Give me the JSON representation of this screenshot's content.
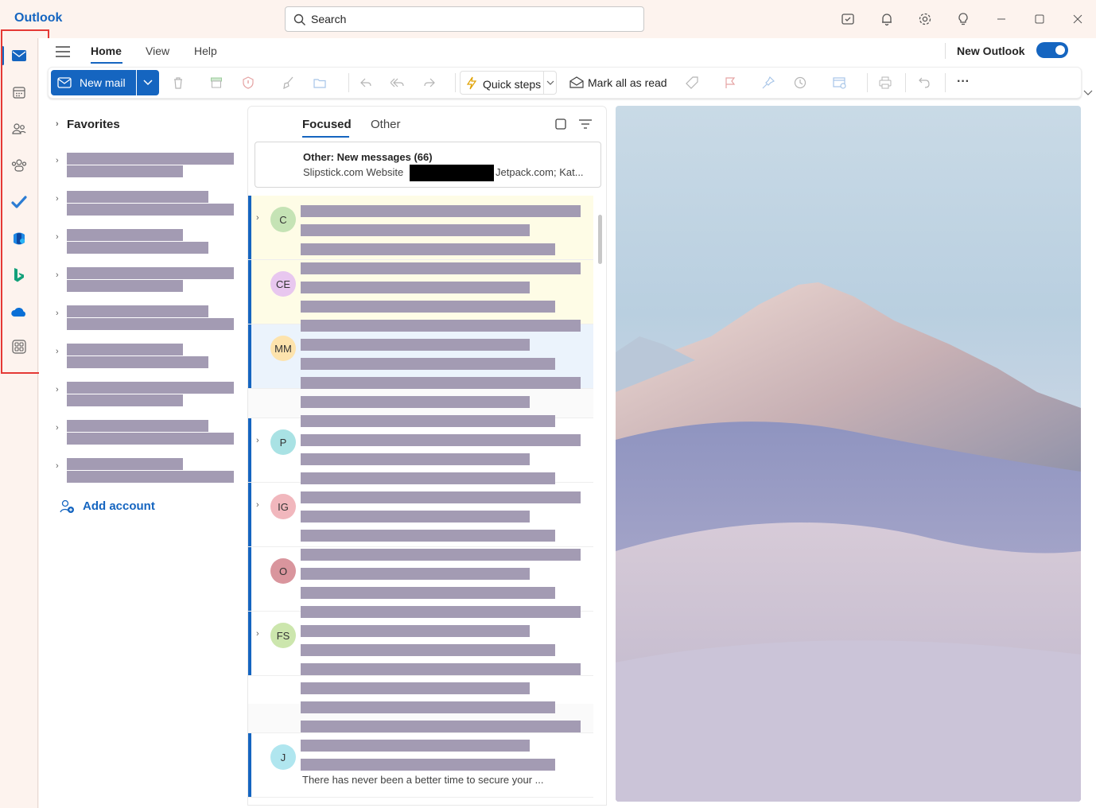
{
  "app": {
    "title": "Outlook"
  },
  "search": {
    "placeholder": "Search"
  },
  "ribbon": {
    "tabs": [
      "Home",
      "View",
      "Help"
    ],
    "new_outlook_label": "New Outlook",
    "new_outlook_on": true
  },
  "toolbar": {
    "new_mail": "New mail",
    "quick_steps": "Quick steps",
    "mark_all_read": "Mark all as read",
    "more": "···"
  },
  "folders": {
    "favorites": "Favorites",
    "add_account": "Add account"
  },
  "message_list": {
    "tab_focused": "Focused",
    "tab_other": "Other",
    "other_banner_title": "Other: New messages (66)",
    "other_banner_senders_a": "Slipstick.com Website",
    "other_banner_senders_b": "Jetpack.com; Kat...",
    "messages": [
      {
        "initials": "C",
        "color": "#c5e3b5"
      },
      {
        "initials": "CE",
        "color": "#e8c7ef"
      },
      {
        "initials": "MM",
        "color": "#fde3ad"
      },
      {
        "initials": "P",
        "color": "#a9e2e4"
      },
      {
        "initials": "IG",
        "color": "#f1b7bd"
      },
      {
        "initials": "O",
        "color": "#d9959d"
      },
      {
        "initials": "FS",
        "color": "#cce6ad"
      },
      {
        "initials": "J",
        "color": "#b0e6ef"
      }
    ],
    "last_snippet": "There has never been a better time to secure your ..."
  },
  "colors": {
    "accent": "#1565c0",
    "rail_highlight": "#e53935",
    "redaction": "#a39bb3"
  }
}
